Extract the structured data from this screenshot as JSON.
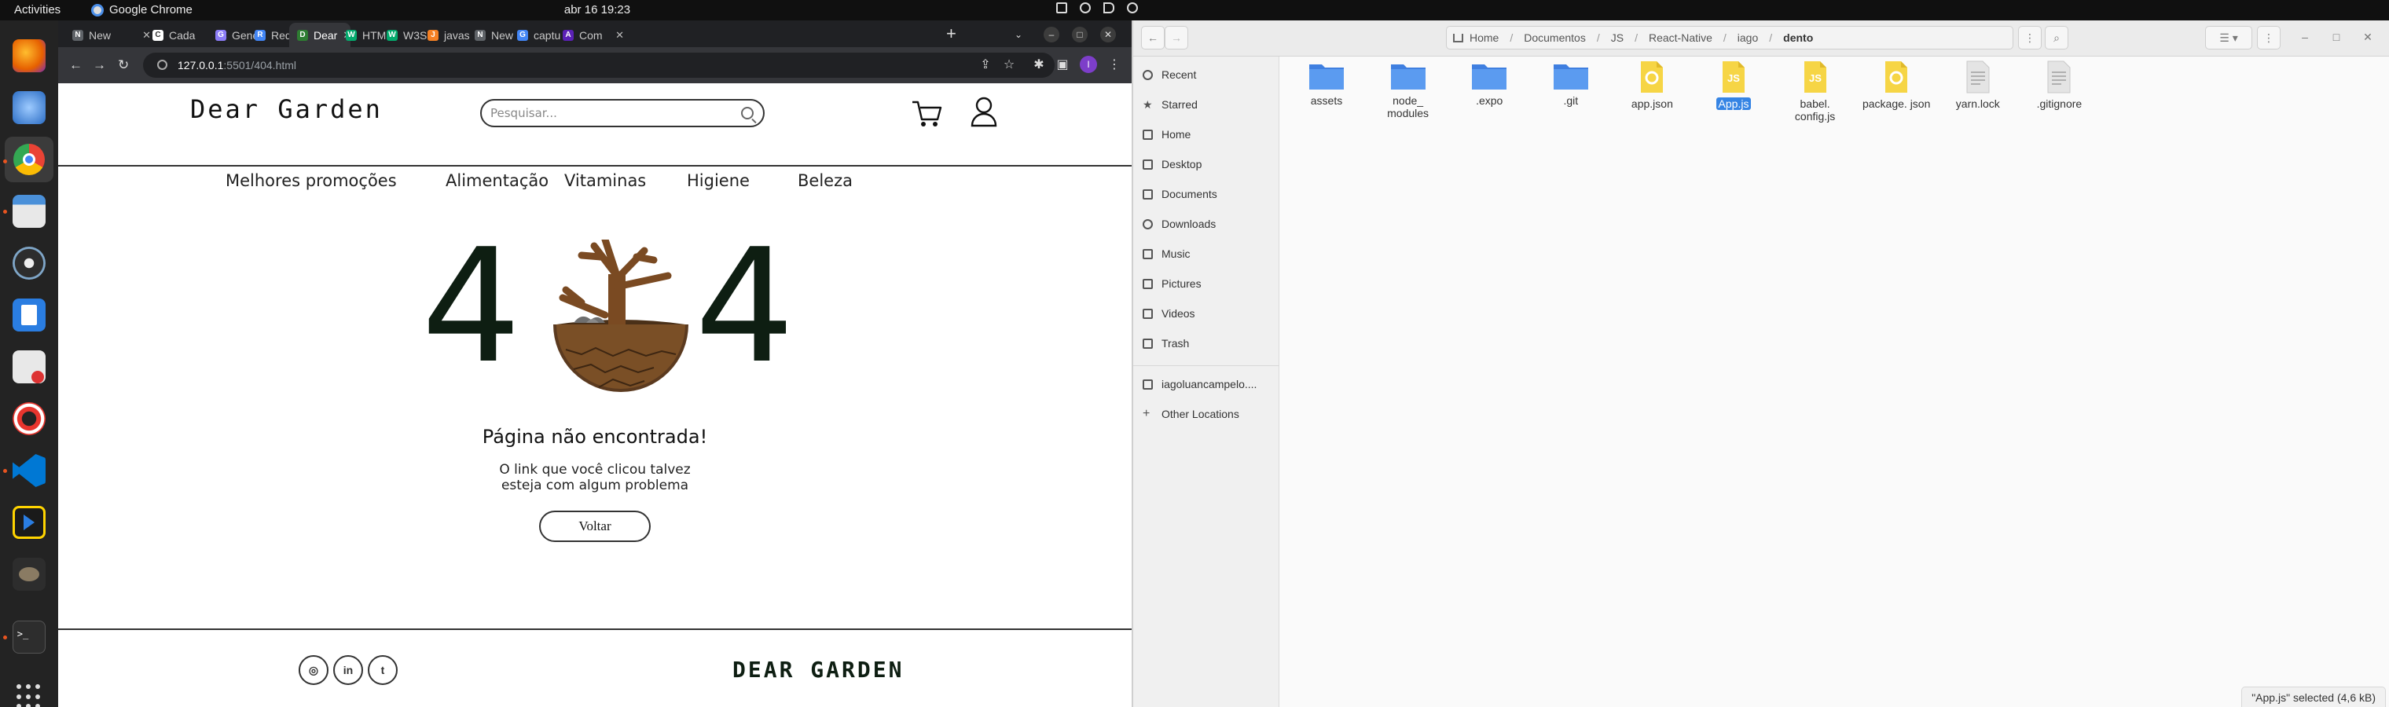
{
  "topbar": {
    "activities": "Activities",
    "app_name": "Google Chrome",
    "clock": "abr 16  19:23"
  },
  "dock": {
    "apps": [
      "firefox-icon",
      "thunderbird-icon",
      "chrome-icon",
      "files-icon",
      "rhythmbox-icon",
      "writer-icon",
      "software-icon",
      "help-icon",
      "vscode-icon",
      "terminal-app-icon",
      "gimp-icon",
      "terminal-icon",
      "show-apps-icon"
    ]
  },
  "browser": {
    "tabs": [
      {
        "label": "New",
        "fav": "N",
        "color": "#5f6368"
      },
      {
        "label": "Cada",
        "fav": "C",
        "color": "#ffffff"
      },
      {
        "label": "Gene",
        "fav": "G",
        "color": "#8b7cf6"
      },
      {
        "label": "Requ",
        "fav": "R",
        "color": "#4285f4"
      },
      {
        "label": "Dear",
        "fav": "D",
        "color": "#2e7d32"
      },
      {
        "label": "HTM",
        "fav": "W",
        "color": "#04aa6d"
      },
      {
        "label": "W3S",
        "fav": "W",
        "color": "#04aa6d"
      },
      {
        "label": "javas",
        "fav": "J",
        "color": "#f48024"
      },
      {
        "label": "New",
        "fav": "N",
        "color": "#5f6368"
      },
      {
        "label": "captu",
        "fav": "G",
        "color": "#4285f4"
      },
      {
        "label": "Com",
        "fav": "A",
        "color": "#5b21b6"
      }
    ],
    "url_host": "127.0.0.1",
    "url_path": ":5501/404.html",
    "profile_initial": "I"
  },
  "site": {
    "brand": "Dear Garden",
    "search_placeholder": "Pesquisar...",
    "nav": [
      "Melhores promoções",
      "Alimentação",
      "Vitaminas",
      "Higiene",
      "Beleza"
    ],
    "error_digit": "4",
    "error_title": "Página não encontrada!",
    "error_line1": "O link que você clicou talvez",
    "error_line2": "esteja com algum problema",
    "back_label": "Voltar",
    "footer_brand": "DEAR GARDEN",
    "social": [
      "instagram-icon",
      "linkedin-icon",
      "twitter-icon"
    ],
    "social_glyphs": [
      "◎",
      "in",
      "t"
    ]
  },
  "files": {
    "path": [
      "Home",
      "Documentos",
      "JS",
      "React-Native",
      "iago",
      "dento"
    ],
    "sidebar": [
      "Recent",
      "Starred",
      "Home",
      "Desktop",
      "Documents",
      "Downloads",
      "Music",
      "Pictures",
      "Videos",
      "Trash",
      "iagoluancampelo....",
      "Other Locations"
    ],
    "items": [
      {
        "name": "assets",
        "kind": "folder"
      },
      {
        "name": "node_ modules",
        "kind": "folder"
      },
      {
        "name": ".expo",
        "kind": "folder"
      },
      {
        "name": ".git",
        "kind": "folder"
      },
      {
        "name": "app.json",
        "kind": "json"
      },
      {
        "name": "App.js",
        "kind": "js",
        "selected": true
      },
      {
        "name": "babel. config.js",
        "kind": "js"
      },
      {
        "name": "package. json",
        "kind": "json"
      },
      {
        "name": "yarn.lock",
        "kind": "text"
      },
      {
        "name": ".gitignore",
        "kind": "text"
      }
    ],
    "status": "\"App.js\" selected  (4,6 kB)"
  }
}
